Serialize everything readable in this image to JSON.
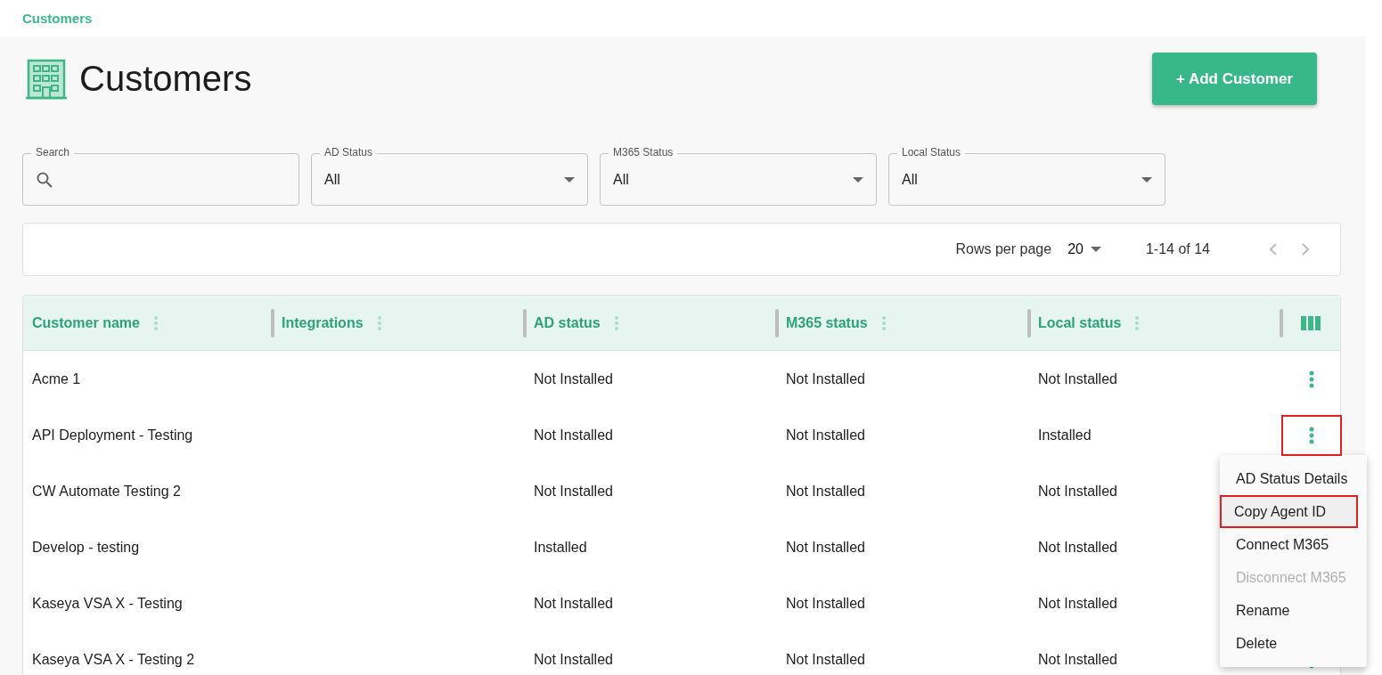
{
  "breadcrumb": "Customers",
  "title": "Customers",
  "add_button": "+ Add Customer",
  "filters": [
    {
      "kind": "search",
      "label": "Search"
    },
    {
      "kind": "select",
      "label": "AD Status",
      "value": "All"
    },
    {
      "kind": "select",
      "label": "M365 Status",
      "value": "All"
    },
    {
      "kind": "select",
      "label": "Local Status",
      "value": "All"
    }
  ],
  "pagination": {
    "rows_per_page_label": "Rows per page",
    "rows_per_page": "20",
    "range": "1-14 of 14"
  },
  "table": {
    "columns": [
      "Customer name",
      "Integrations",
      "AD status",
      "M365 status",
      "Local status"
    ],
    "rows": [
      {
        "cells": [
          "Acme 1",
          "",
          "Not Installed",
          "Not Installed",
          "Not Installed"
        ],
        "highlighted": false
      },
      {
        "cells": [
          "API Deployment - Testing",
          "",
          "Not Installed",
          "Not Installed",
          "Installed"
        ],
        "highlighted": true
      },
      {
        "cells": [
          "CW Automate Testing 2",
          "",
          "Not Installed",
          "Not Installed",
          "Not Installed"
        ],
        "highlighted": false
      },
      {
        "cells": [
          "Develop - testing",
          "",
          "Installed",
          "Not Installed",
          "Not Installed"
        ],
        "highlighted": false
      },
      {
        "cells": [
          "Kaseya VSA X - Testing",
          "",
          "Not Installed",
          "Not Installed",
          "Not Installed"
        ],
        "highlighted": false
      },
      {
        "cells": [
          "Kaseya VSA X - Testing 2",
          "",
          "Not Installed",
          "Not Installed",
          "Not Installed"
        ],
        "highlighted": false
      }
    ]
  },
  "menu": [
    {
      "label": "AD Status Details",
      "disabled": false,
      "highlighted": false
    },
    {
      "label": "Copy Agent ID",
      "disabled": false,
      "highlighted": true
    },
    {
      "label": "Connect M365",
      "disabled": false,
      "highlighted": false
    },
    {
      "label": "Disconnect M365",
      "disabled": true,
      "highlighted": false
    },
    {
      "label": "Rename",
      "disabled": false,
      "highlighted": false
    },
    {
      "label": "Delete",
      "disabled": false,
      "highlighted": false
    }
  ]
}
